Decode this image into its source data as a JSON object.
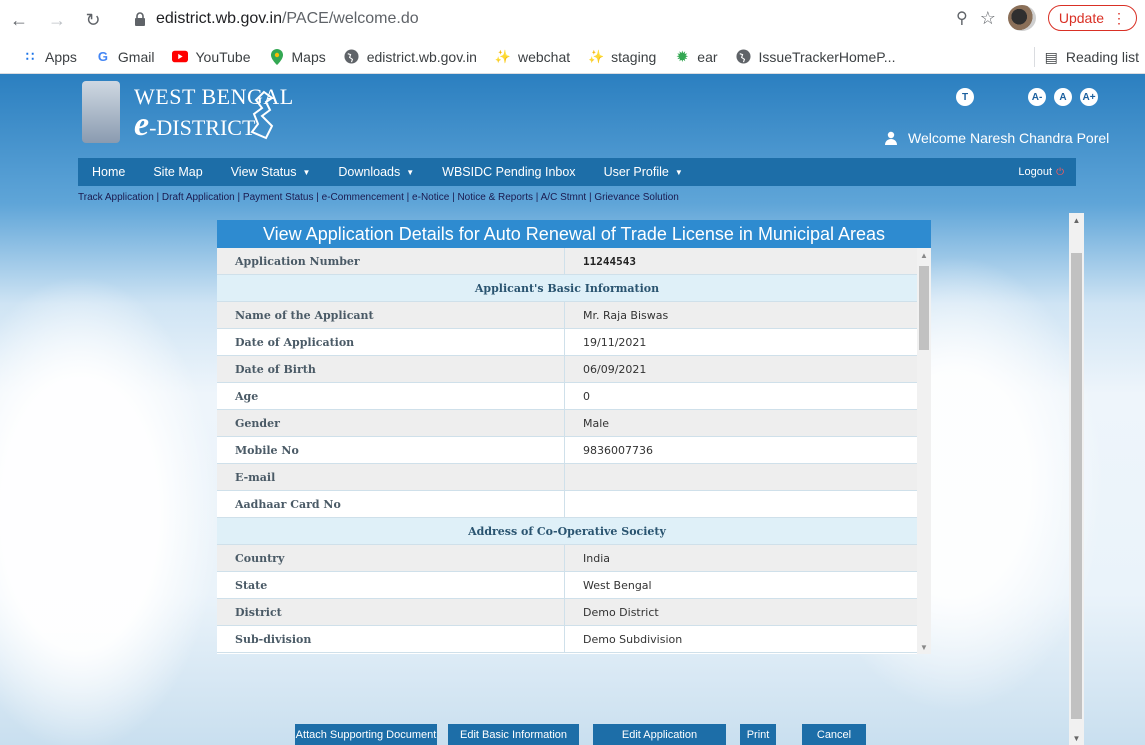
{
  "browser": {
    "url_host": "edistrict.wb.gov.in",
    "url_path": "/PACE/welcome.do",
    "update_label": "Update",
    "bookmarks": [
      "Apps",
      "Gmail",
      "YouTube",
      "Maps",
      "edistrict.wb.gov.in",
      "webchat",
      "staging",
      "ear",
      "IssueTrackerHomeP..."
    ],
    "reading_list": "Reading list"
  },
  "header": {
    "brand_line1": "WEST BENGAL",
    "brand_line2_e": "e",
    "brand_line2_rest": "-DISTRICT",
    "access_buttons": [
      "T",
      "A-",
      "A",
      "A+"
    ],
    "welcome": "Welcome Naresh Chandra Porel"
  },
  "menu": {
    "items": [
      "Home",
      "Site Map",
      "View Status",
      "Downloads",
      "WBSIDC Pending Inbox",
      "User Profile"
    ],
    "logout": "Logout"
  },
  "submenu": "Track Application | Draft Application | Payment Status | e-Commencement | e-Notice | Notice & Reports | A/C Stmnt | Grievance Solution",
  "panel": {
    "title": "View Application Details for Auto Renewal of Trade License in Municipal Areas",
    "application_number_label": "Application Number",
    "application_number": "11244543",
    "section_basic": "Applicant's Basic Information",
    "basic_rows": [
      {
        "label": "Name of the Applicant",
        "value": "Mr. Raja Biswas"
      },
      {
        "label": "Date of Application",
        "value": "19/11/2021"
      },
      {
        "label": "Date of Birth",
        "value": "06/09/2021"
      },
      {
        "label": "Age",
        "value": "0"
      },
      {
        "label": "Gender",
        "value": "Male"
      },
      {
        "label": "Mobile No",
        "value": "9836007736"
      },
      {
        "label": "E-mail",
        "value": ""
      },
      {
        "label": "Aadhaar Card No",
        "value": ""
      }
    ],
    "section_address": "Address of Co-Operative Society",
    "address_rows": [
      {
        "label": "Country",
        "value": "India"
      },
      {
        "label": "State",
        "value": "West Bengal"
      },
      {
        "label": "District",
        "value": "Demo District"
      },
      {
        "label": "Sub-division",
        "value": "Demo Subdivision"
      }
    ]
  },
  "buttons": {
    "attach": "Attach Supporting Document",
    "edit_basic": "Edit Basic Information",
    "edit_app": "Edit Application",
    "print": "Print",
    "cancel": "Cancel"
  }
}
